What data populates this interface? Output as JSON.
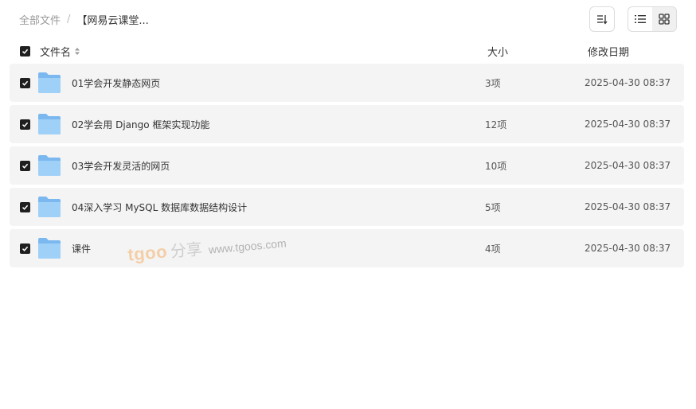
{
  "breadcrumb": {
    "root": "全部文件",
    "separator": "/",
    "current": "【网易云课堂..."
  },
  "toolbar": {
    "sort_icon": "sort-icon",
    "list_view_icon": "list-view-icon",
    "grid_view_icon": "grid-view-icon",
    "active_view": "grid"
  },
  "table": {
    "headers": {
      "name": "文件名",
      "size": "大小",
      "date": "修改日期"
    },
    "all_selected": true,
    "rows": [
      {
        "name": "01学会开发静态网页",
        "size": "3项",
        "date": "2025-04-30 08:37",
        "selected": true
      },
      {
        "name": "02学会用 Django 框架实现功能",
        "size": "12项",
        "date": "2025-04-30 08:37",
        "selected": true
      },
      {
        "name": "03学会开发灵活的网页",
        "size": "10项",
        "date": "2025-04-30 08:37",
        "selected": true
      },
      {
        "name": "04深入学习 MySQL 数据库数据结构设计",
        "size": "5项",
        "date": "2025-04-30 08:37",
        "selected": true
      },
      {
        "name": "课件",
        "size": "4项",
        "date": "2025-04-30 08:37",
        "selected": true
      }
    ]
  },
  "watermark": {
    "brand": "tgoo",
    "share": "分享",
    "url": "www.tgoos.com"
  },
  "colors": {
    "row_bg": "#f4f4f4",
    "checkbox": "#1f1f1f",
    "folder": "#8ec6f5"
  }
}
